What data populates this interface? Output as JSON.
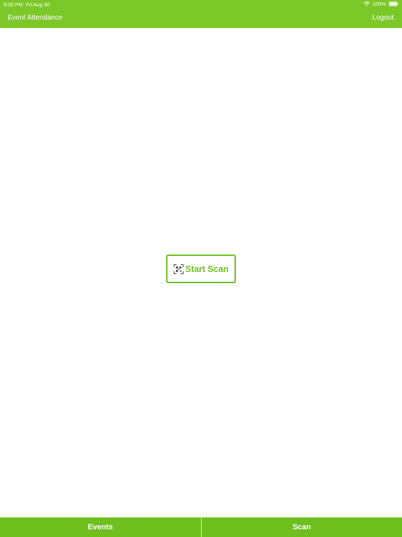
{
  "status_bar": {
    "time": "9:00 PM",
    "date": "Fri Aug 30",
    "battery": "100%"
  },
  "nav": {
    "title": "Event Attendance",
    "logout_label": "Logout"
  },
  "main": {
    "start_scan_label": "Start Scan",
    "start_scan_icon": "qr-code-icon"
  },
  "tabs": [
    {
      "label": "Events"
    },
    {
      "label": "Scan"
    }
  ],
  "colors": {
    "header": "#7cc828",
    "accent": "#6fbf1e",
    "background": "#ffffff"
  }
}
